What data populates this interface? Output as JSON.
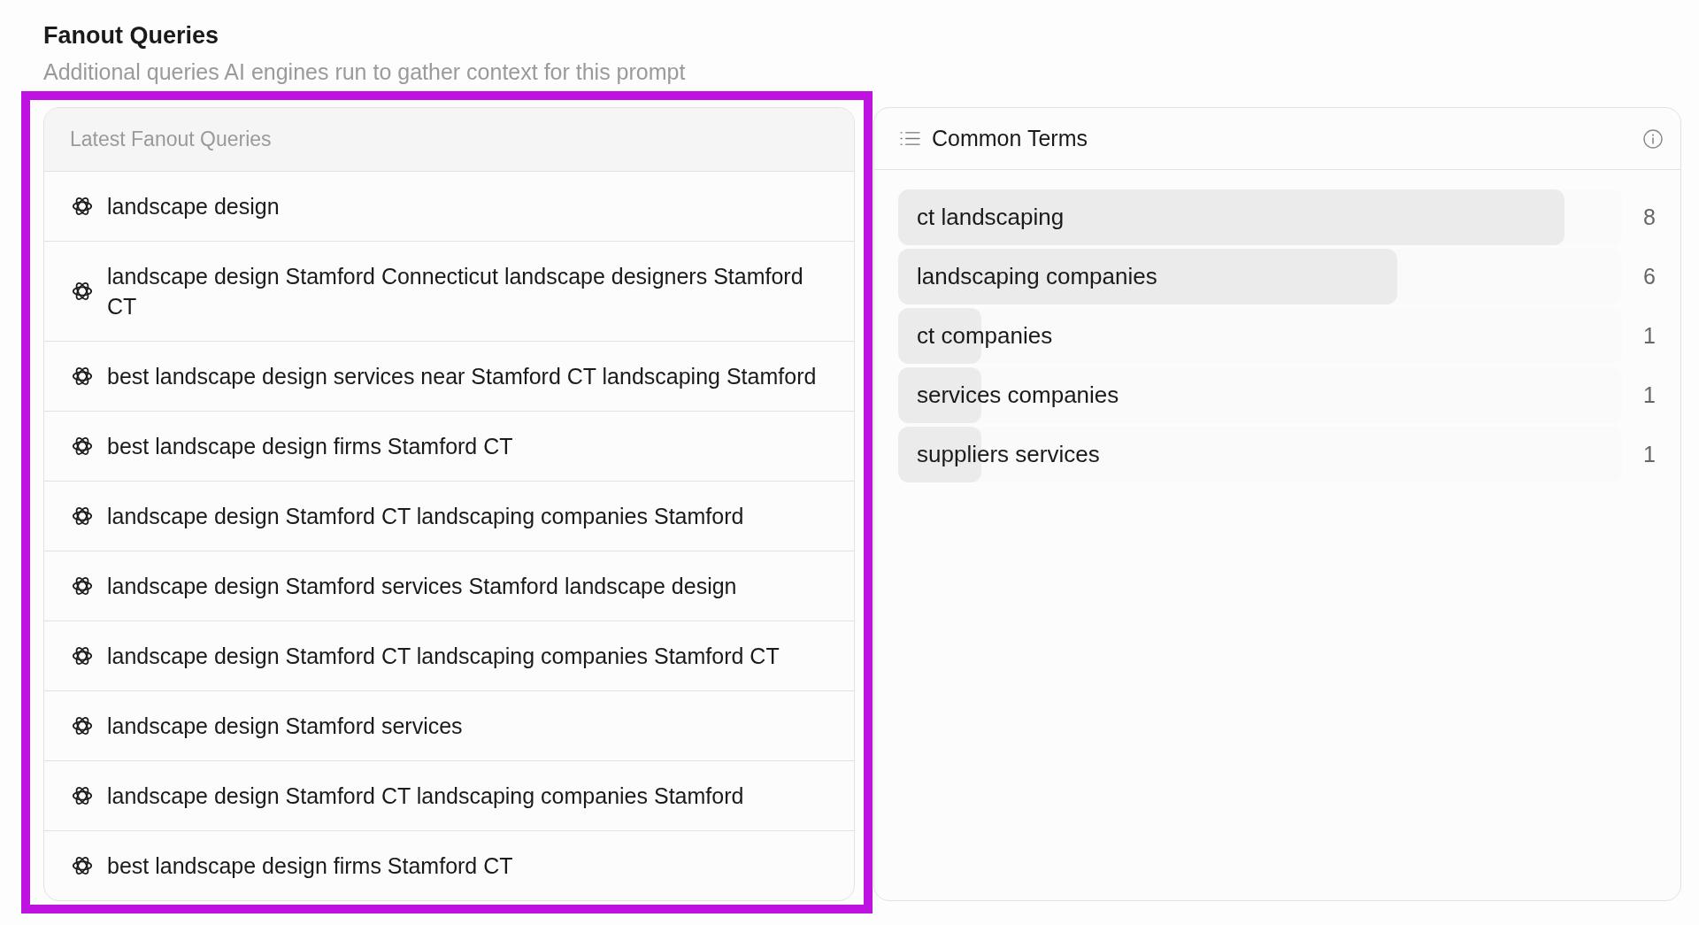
{
  "section": {
    "title": "Fanout Queries",
    "subtitle": "Additional queries AI engines run to gather context for this prompt"
  },
  "queries_panel": {
    "highlighted": true,
    "header": "Latest Fanout Queries",
    "items": [
      "landscape design",
      "landscape design Stamford Connecticut landscape designers Stamford CT",
      "best landscape design services near Stamford CT landscaping Stamford",
      "best landscape design firms Stamford CT",
      "landscape design Stamford CT landscaping companies Stamford",
      "landscape design Stamford services Stamford landscape design",
      "landscape design Stamford CT landscaping companies Stamford CT",
      "landscape design Stamford services",
      "landscape design Stamford CT landscaping companies Stamford",
      "best landscape design firms Stamford CT"
    ]
  },
  "common_terms": {
    "title": "Common Terms",
    "terms": [
      {
        "term": "ct landscaping",
        "count": "8",
        "level": 0.92
      },
      {
        "term": "landscaping companies",
        "count": "6",
        "level": 0.69
      },
      {
        "term": "ct companies",
        "count": "1",
        "level": 0.115
      },
      {
        "term": "services companies",
        "count": "1",
        "level": 0.115
      },
      {
        "term": "suppliers services",
        "count": "1",
        "level": 0.115
      }
    ]
  }
}
